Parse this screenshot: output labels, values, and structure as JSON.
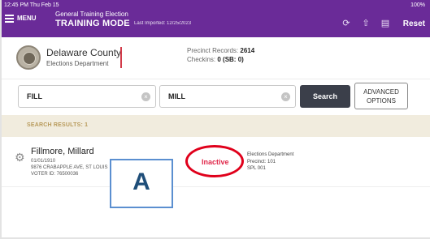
{
  "status_bar": {
    "time": "12:45 PM Thu Feb 15",
    "battery": "100%"
  },
  "header": {
    "menu_label": "MENU",
    "election_name": "General Training Election",
    "mode_label": "TRAINING MODE",
    "last_imported": "Last Imported: 12/25/2023",
    "reset_label": "Reset",
    "icons": [
      "sync-icon",
      "upload-icon",
      "network-icon"
    ]
  },
  "county": {
    "name": "Delaware County",
    "department": "Elections Department",
    "precinct_records_label": "Precinct Records:",
    "precinct_records_value": "2614",
    "checkins_label": "Checkins:",
    "checkins_value": "0 (SB: 0)"
  },
  "search": {
    "last_name_value": "FILL",
    "first_name_value": "MILL",
    "search_label": "Search",
    "advanced_line1": "ADVANCED",
    "advanced_line2": "OPTIONS"
  },
  "results": {
    "label": "SEARCH RESULTS: 1"
  },
  "voter": {
    "name": "Fillmore, Millard",
    "dob": "01/01/1910",
    "address": "9876 CRABAPPLE AVE, ST LOUIS",
    "voter_id": "VOTER ID: 76500036",
    "status": "Inactive",
    "dept": "Elections Department",
    "precinct": "Precinct: 101",
    "split": "SPL 001"
  },
  "annotation": {
    "label": "A"
  },
  "colors": {
    "header_purple": "#6a2b98",
    "status_red": "#e0294b",
    "results_bg": "#f1ecde"
  }
}
